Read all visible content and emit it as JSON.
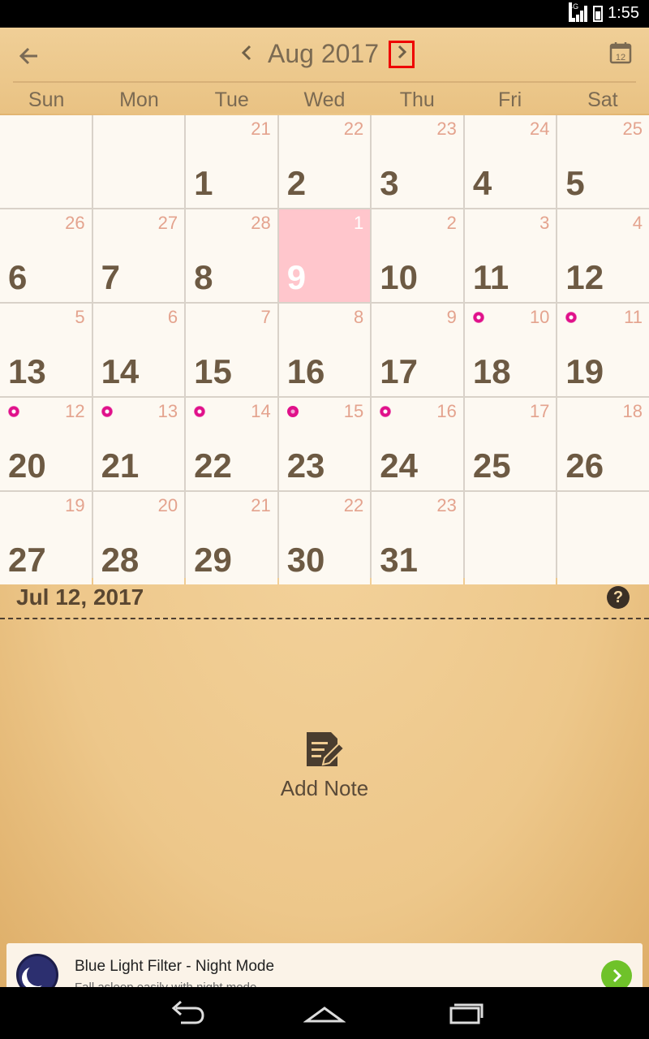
{
  "status": {
    "time": "1:55",
    "network": "4G"
  },
  "header": {
    "month_title": "Aug 2017",
    "weekdays": [
      "Sun",
      "Mon",
      "Tue",
      "Wed",
      "Thu",
      "Fri",
      "Sat"
    ],
    "icons": {
      "back": "arrow-left-icon",
      "prev": "chevron-left-icon",
      "next": "chevron-right-icon",
      "today": "calendar-icon"
    },
    "today_icon_number": "12"
  },
  "calendar": {
    "weeks": [
      [
        {
          "day": "",
          "lunar": ""
        },
        {
          "day": "",
          "lunar": ""
        },
        {
          "day": "1",
          "lunar": "21"
        },
        {
          "day": "2",
          "lunar": "22"
        },
        {
          "day": "3",
          "lunar": "23"
        },
        {
          "day": "4",
          "lunar": "24"
        },
        {
          "day": "5",
          "lunar": "25"
        }
      ],
      [
        {
          "day": "6",
          "lunar": "26"
        },
        {
          "day": "7",
          "lunar": "27"
        },
        {
          "day": "8",
          "lunar": "28"
        },
        {
          "day": "9",
          "lunar": "1",
          "today": true
        },
        {
          "day": "10",
          "lunar": "2"
        },
        {
          "day": "11",
          "lunar": "3"
        },
        {
          "day": "12",
          "lunar": "4"
        }
      ],
      [
        {
          "day": "13",
          "lunar": "5"
        },
        {
          "day": "14",
          "lunar": "6"
        },
        {
          "day": "15",
          "lunar": "7"
        },
        {
          "day": "16",
          "lunar": "8"
        },
        {
          "day": "17",
          "lunar": "9"
        },
        {
          "day": "18",
          "lunar": "10",
          "dot": "ring"
        },
        {
          "day": "19",
          "lunar": "11",
          "dot": "ring"
        }
      ],
      [
        {
          "day": "20",
          "lunar": "12",
          "dot": "ring"
        },
        {
          "day": "21",
          "lunar": "13",
          "dot": "ring"
        },
        {
          "day": "22",
          "lunar": "14",
          "dot": "ring"
        },
        {
          "day": "23",
          "lunar": "15",
          "dot": "solid"
        },
        {
          "day": "24",
          "lunar": "16",
          "dot": "ring"
        },
        {
          "day": "25",
          "lunar": "17"
        },
        {
          "day": "26",
          "lunar": "18"
        }
      ],
      [
        {
          "day": "27",
          "lunar": "19"
        },
        {
          "day": "28",
          "lunar": "20"
        },
        {
          "day": "29",
          "lunar": "21"
        },
        {
          "day": "30",
          "lunar": "22"
        },
        {
          "day": "31",
          "lunar": "23"
        },
        {
          "day": "",
          "lunar": ""
        },
        {
          "day": "",
          "lunar": ""
        }
      ]
    ],
    "colors": {
      "today_bg": "#ffc6cc",
      "dot": "#e0118a",
      "lunar": "#e4a38e"
    }
  },
  "notes": {
    "selected_date": "Jul 12, 2017",
    "help_icon": "question-icon",
    "add_note_label": "Add Note",
    "add_note_icon": "edit-note-icon"
  },
  "ad": {
    "title": "Blue Light Filter - Night Mode",
    "subtitle": "Fall asleep easily with night mode",
    "icon": "moon-icon",
    "cta_icon": "chevron-right-icon"
  },
  "navbar": {
    "icons": [
      "back-icon",
      "home-icon",
      "recent-apps-icon"
    ]
  }
}
